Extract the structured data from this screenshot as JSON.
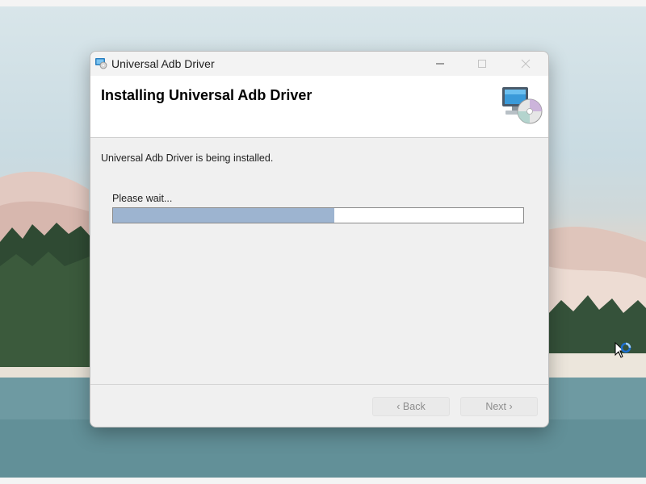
{
  "window": {
    "title": "Universal Adb Driver",
    "controls": {
      "minimize_icon": "minimize-icon",
      "maximize_icon": "maximize-icon",
      "close_icon": "close-icon"
    }
  },
  "header": {
    "title": "Installing Universal Adb Driver",
    "icon": "computer-cd-icon"
  },
  "main": {
    "status_text": "Universal Adb Driver is being installed.",
    "wait_label": "Please wait...",
    "progress_fraction": 0.54
  },
  "buttons": {
    "back_label": "‹ Back",
    "next_label": "Next ›"
  },
  "colors": {
    "progress_fill": "#9db4d0",
    "window_bg": "#f0f0f0",
    "header_bg": "#ffffff"
  }
}
